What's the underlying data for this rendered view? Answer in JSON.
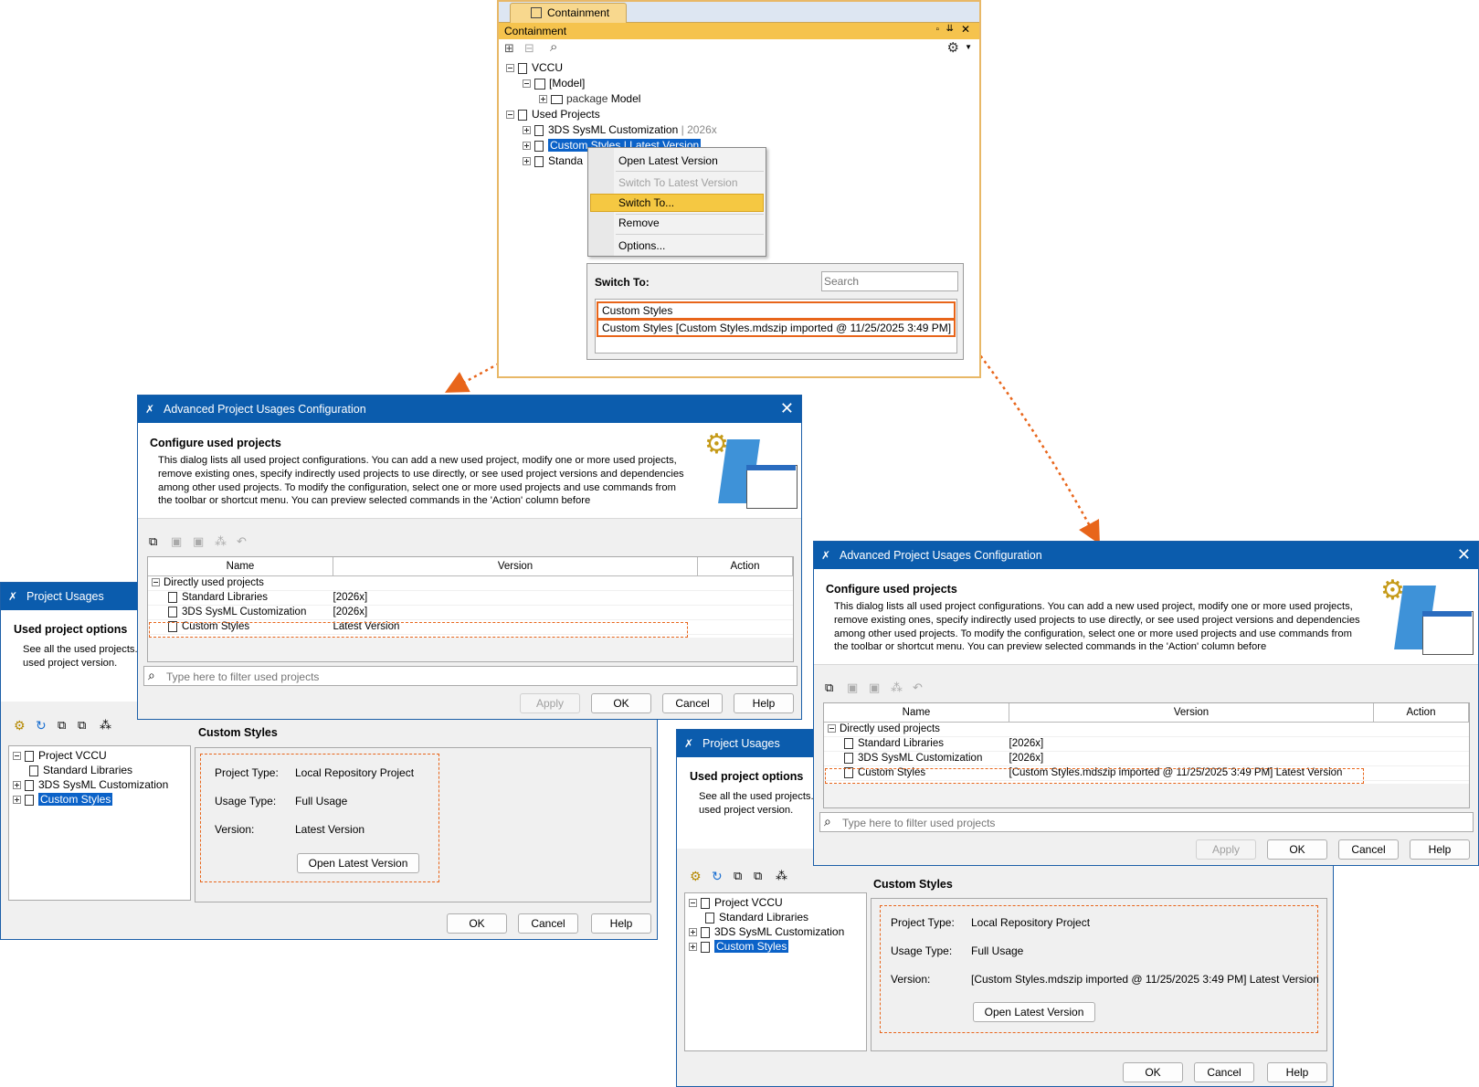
{
  "containment": {
    "tab_label": "Containment",
    "panel_title": "Containment",
    "tree": {
      "root": "VCCU",
      "model": "[Model]",
      "package_keyword": "package",
      "package_name": "Model",
      "used_projects": "Used Projects",
      "item_sysml": "3DS SysML Customization",
      "item_sysml_version": "| 2026x",
      "item_custom": "Custom Styles | Latest Version",
      "item_standard": "Standa"
    },
    "context_menu": [
      "Open Latest Version",
      "Switch To Latest Version",
      "Switch To...",
      "Remove",
      "Options..."
    ],
    "switch_to": {
      "label": "Switch To:",
      "search_placeholder": "Search",
      "options": [
        "Custom Styles",
        "Custom Styles [Custom Styles.mdszip imported @ 11/25/2025 3:49 PM]"
      ]
    }
  },
  "adv_dialog_left": {
    "title": "Advanced Project Usages Configuration",
    "heading": "Configure used projects",
    "description": "This dialog lists all used project configurations. You can add a new used project, modify one or more used projects, remove existing ones, specify indirectly used projects to use directly, or see used project versions and dependencies among other used projects. To modify the configuration, select one or more used projects and use commands from the toolbar or shortcut menu. You can preview selected commands in the 'Action' column before",
    "columns": [
      "Name",
      "Version",
      "Action"
    ],
    "group": "Directly used projects",
    "rows": [
      {
        "name": "Standard Libraries",
        "version": "[2026x]"
      },
      {
        "name": "3DS SysML Customization",
        "version": "[2026x]"
      },
      {
        "name": "Custom Styles",
        "version": "Latest Version"
      }
    ],
    "filter_placeholder": "Type here to filter used projects",
    "buttons": {
      "apply": "Apply",
      "ok": "OK",
      "cancel": "Cancel",
      "help": "Help"
    }
  },
  "adv_dialog_right": {
    "title": "Advanced Project Usages Configuration",
    "heading": "Configure used projects",
    "description": "This dialog lists all used project configurations. You can add a new used project, modify one or more used projects, remove existing ones, specify indirectly used projects to use directly, or see used project versions and dependencies among other used projects. To modify the configuration, select one or more used projects and use commands from the toolbar or shortcut menu. You can preview selected commands in the 'Action' column before",
    "columns": [
      "Name",
      "Version",
      "Action"
    ],
    "group": "Directly used projects",
    "rows": [
      {
        "name": "Standard Libraries",
        "version": "[2026x]"
      },
      {
        "name": "3DS SysML Customization",
        "version": "[2026x]"
      },
      {
        "name": "Custom Styles",
        "version": "[Custom Styles.mdszip imported @ 11/25/2025 3:49 PM] Latest Version"
      }
    ],
    "filter_placeholder": "Type here to filter used projects",
    "buttons": {
      "apply": "Apply",
      "ok": "OK",
      "cancel": "Cancel",
      "help": "Help"
    }
  },
  "pu_left": {
    "title": "Project Usages",
    "heading": "Used project options",
    "description": "See all the used projects. used project version.",
    "tree_root": "Project VCCU",
    "tree_items": [
      "Standard Libraries",
      "3DS SysML Customization",
      "Custom Styles"
    ],
    "detail_title": "Custom Styles",
    "project_type_label": "Project Type:",
    "project_type_value": "Local Repository Project",
    "usage_type_label": "Usage Type:",
    "usage_type_value": "Full Usage",
    "version_label": "Version:",
    "version_value": "Latest Version",
    "open_latest": "Open Latest Version",
    "buttons": {
      "ok": "OK",
      "cancel": "Cancel",
      "help": "Help"
    }
  },
  "pu_right": {
    "title": "Project Usages",
    "heading": "Used project options",
    "description": "See all the used projects. used project version.",
    "tree_root": "Project VCCU",
    "tree_items": [
      "Standard Libraries",
      "3DS SysML Customization",
      "Custom Styles"
    ],
    "detail_title": "Custom Styles",
    "project_type_label": "Project Type:",
    "project_type_value": "Local Repository Project",
    "usage_type_label": "Usage Type:",
    "usage_type_value": "Full Usage",
    "version_label": "Version:",
    "version_value": "[Custom Styles.mdszip imported @ 11/25/2025 3:49 PM] Latest Version",
    "open_latest": "Open Latest Version",
    "buttons": {
      "ok": "OK",
      "cancel": "Cancel",
      "help": "Help"
    }
  },
  "colors": {
    "accent": "#0b5cad",
    "highlight": "#f7c642",
    "callout": "#e8651a",
    "selection": "#0b62c8"
  }
}
